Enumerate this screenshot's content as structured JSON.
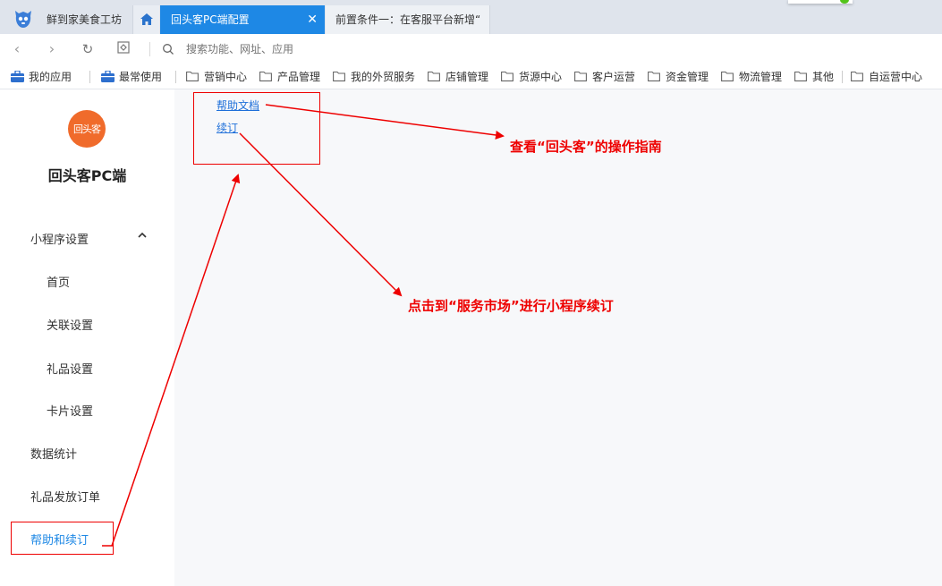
{
  "tabs": {
    "first": "鲜到家美食工坊",
    "active": "回头客PC端配置",
    "active_close": "✕",
    "third": "前置条件一：在客服平台新增“"
  },
  "addressbar": {
    "placeholder": "搜索功能、网址、应用"
  },
  "bookmarks": [
    {
      "label": "我的应用",
      "icon": "briefcase-icon"
    },
    {
      "label": "最常使用",
      "icon": "briefcase-icon"
    },
    {
      "label": "营销中心",
      "icon": "folder-icon"
    },
    {
      "label": "产品管理",
      "icon": "folder-icon"
    },
    {
      "label": "我的外贸服务",
      "icon": "folder-icon"
    },
    {
      "label": "店铺管理",
      "icon": "folder-icon"
    },
    {
      "label": "货源中心",
      "icon": "folder-icon"
    },
    {
      "label": "客户运营",
      "icon": "folder-icon"
    },
    {
      "label": "资金管理",
      "icon": "folder-icon"
    },
    {
      "label": "物流管理",
      "icon": "folder-icon"
    },
    {
      "label": "其他",
      "icon": "folder-icon"
    },
    {
      "label": "自运营中心",
      "icon": "folder-icon"
    }
  ],
  "sidebar": {
    "logo_text": "回头客",
    "title": "回头客PC端",
    "items": [
      {
        "label": "小程序设置"
      },
      {
        "label": "首页"
      },
      {
        "label": "关联设置"
      },
      {
        "label": "礼品设置"
      },
      {
        "label": "卡片设置"
      },
      {
        "label": "数据统计"
      },
      {
        "label": "礼品发放订单"
      },
      {
        "label": "帮助和续订"
      }
    ]
  },
  "main": {
    "help_link": "帮助文档",
    "renew_link": "续订"
  },
  "annotations": {
    "help_note": "查看“回头客”的操作指南",
    "renew_note": "点击到“服务市场”进行小程序续订",
    "color": "#ee0000"
  },
  "colors": {
    "accent": "#1e88e5",
    "tabbar": "#dfe4ec",
    "logo": "#f06b2b"
  }
}
